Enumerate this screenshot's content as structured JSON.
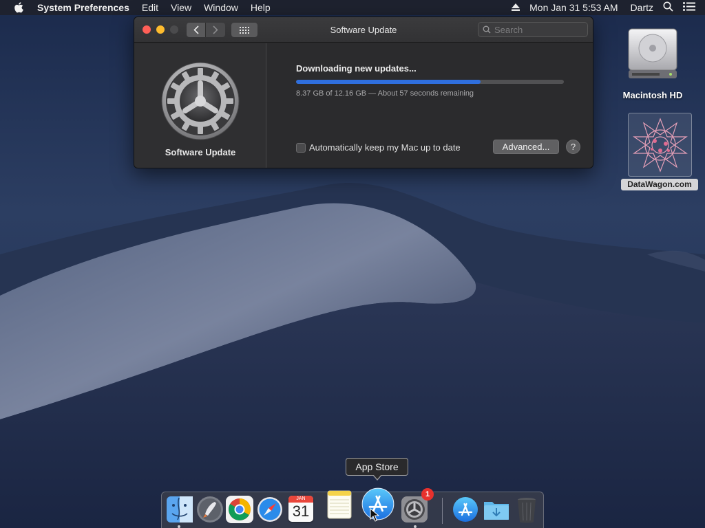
{
  "menubar": {
    "app_name": "System Preferences",
    "menus": [
      "Edit",
      "View",
      "Window",
      "Help"
    ],
    "clock": "Mon Jan 31  5:53 AM",
    "user": "Dartz"
  },
  "window": {
    "title": "Software Update",
    "search_placeholder": "Search",
    "sidebar_label": "Software Update",
    "status_title": "Downloading new updates...",
    "progress_fraction": 0.688,
    "progress_detail": "8.37 GB of 12.16 GB — About 57 seconds remaining",
    "auto_update_label": "Automatically keep my Mac up to date",
    "auto_update_checked": false,
    "advanced_label": "Advanced...",
    "help_label": "?"
  },
  "desktop": {
    "hd_label": "Macintosh HD",
    "dw_label": "DataWagon.com"
  },
  "dock": {
    "tooltip": "App Store",
    "calendar_month": "JAN",
    "calendar_day": "31",
    "badge_count": "1",
    "items": [
      "finder-icon",
      "launchpad-icon",
      "chrome-icon",
      "safari-icon",
      "calendar-icon",
      "notes-icon",
      "app-store-icon",
      "system-preferences-icon",
      "app-store-2-icon",
      "downloads-folder-icon",
      "trash-icon"
    ]
  },
  "colors": {
    "accent": "#2f6fde",
    "close": "#ff5f57",
    "minimize": "#febc2e",
    "badge": "#e8312d"
  }
}
